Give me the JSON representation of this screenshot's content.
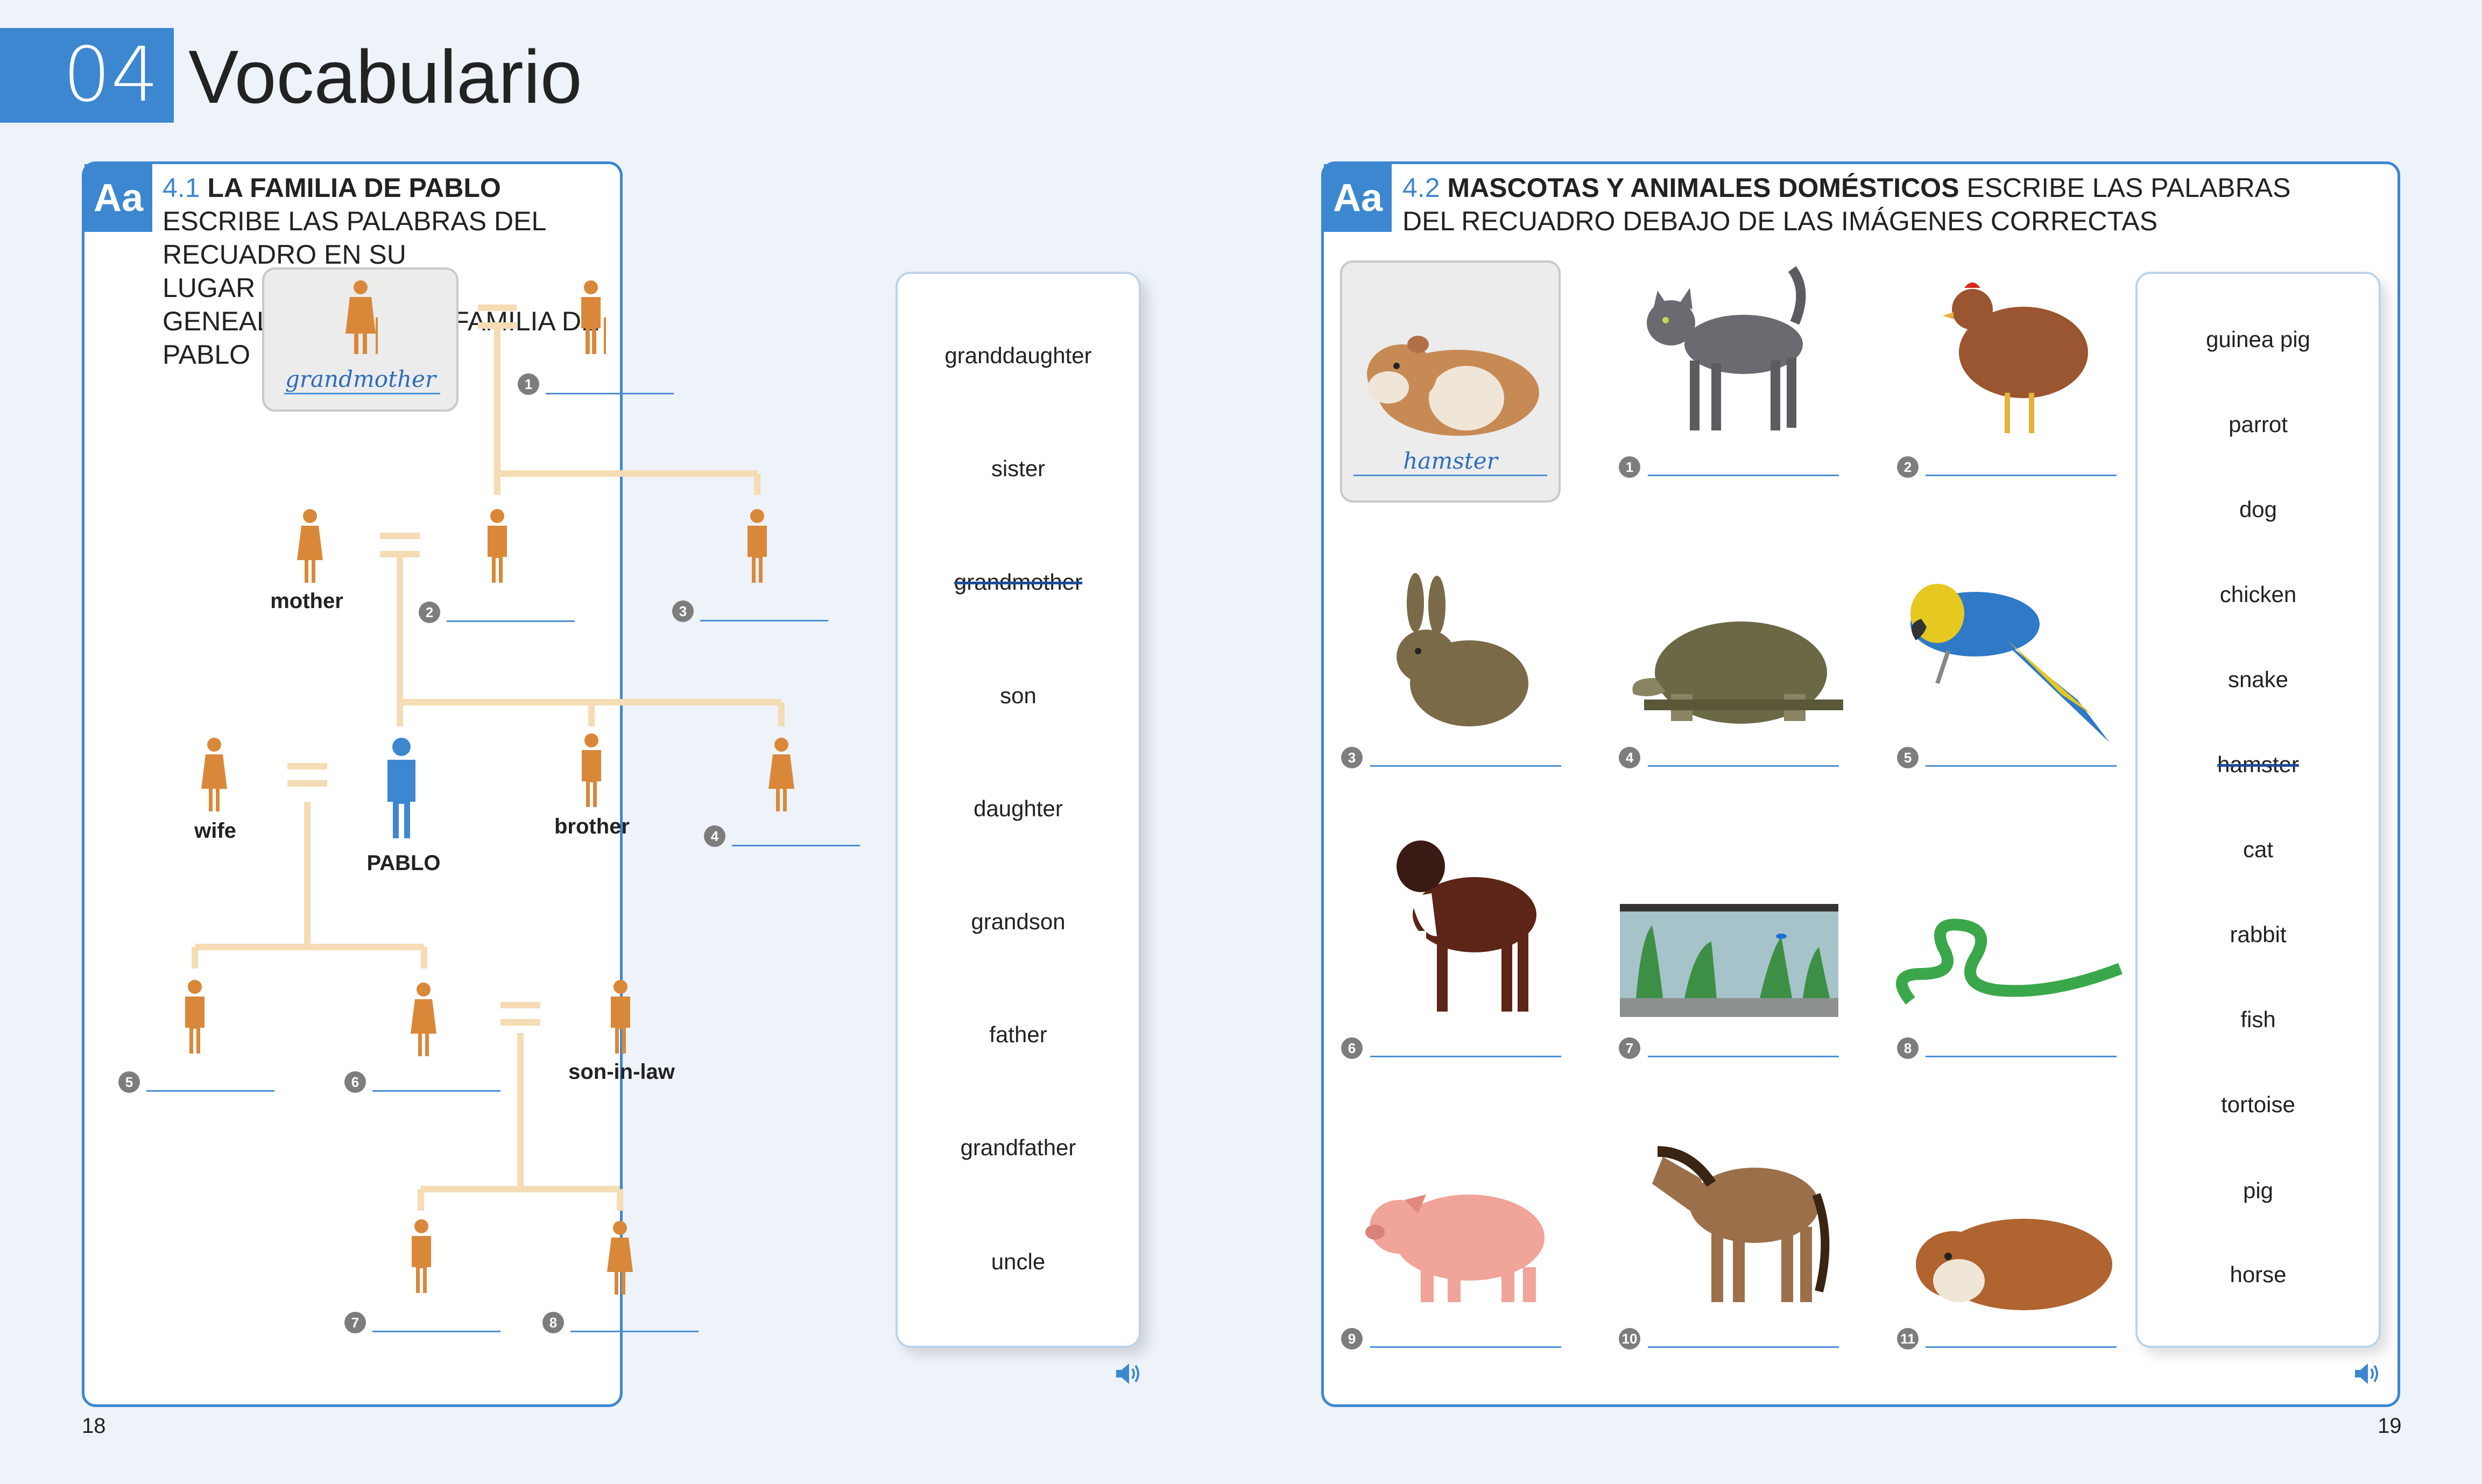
{
  "header": {
    "chapter_number": "04",
    "chapter_title": "Vocabulario"
  },
  "left": {
    "badge": "Aa",
    "ex_number": "4.1",
    "ex_title_bold": "LA FAMILIA DE PABLO",
    "ex_instruction_line1": "ESCRIBE LAS PALABRAS DEL RECUADRO EN SU",
    "ex_instruction_line2": "LUGAR EN EL ÁRBOL GENEALÓGICO DE LA FAMILIA DE PABLO",
    "example_answer": "grandmother",
    "labels": {
      "mother": "mother",
      "wife": "wife",
      "pablo": "PABLO",
      "brother": "brother",
      "son_in_law": "son-in-law"
    },
    "numbers": [
      "1",
      "2",
      "3",
      "4",
      "5",
      "6",
      "7",
      "8"
    ],
    "words": [
      "granddaughter",
      "sister",
      "grandmother",
      "son",
      "daughter",
      "grandson",
      "father",
      "grandfather",
      "uncle"
    ],
    "struck_word_index": 2,
    "page_number": "18"
  },
  "right": {
    "badge": "Aa",
    "ex_number": "4.2",
    "ex_title_bold": "MASCOTAS Y ANIMALES DOMÉSTICOS",
    "ex_instruction_line1": "ESCRIBE LAS PALABRAS",
    "ex_instruction_line2": "DEL RECUADRO DEBAJO DE LAS IMÁGENES CORRECTAS",
    "example_answer": "hamster",
    "numbers": [
      "1",
      "2",
      "3",
      "4",
      "5",
      "6",
      "7",
      "8",
      "9",
      "10",
      "11"
    ],
    "animals": [
      "hamster-image",
      "cat-image",
      "chicken-image",
      "rabbit-image",
      "tortoise-image",
      "parrot-image",
      "dog-image",
      "fish-tank-image",
      "snake-image",
      "pig-image",
      "horse-image",
      "guinea-pig-image"
    ],
    "words": [
      "guinea pig",
      "parrot",
      "dog",
      "chicken",
      "snake",
      "hamster",
      "cat",
      "rabbit",
      "fish",
      "tortoise",
      "pig",
      "horse"
    ],
    "struck_word_index": 5,
    "page_number": "19"
  },
  "colors": {
    "accent": "#3d87d1",
    "figure": "#d9883a",
    "pablo": "#3d87d1",
    "tree_line": "#f5dcb4"
  },
  "icons": {
    "audio": "speaker-icon"
  }
}
